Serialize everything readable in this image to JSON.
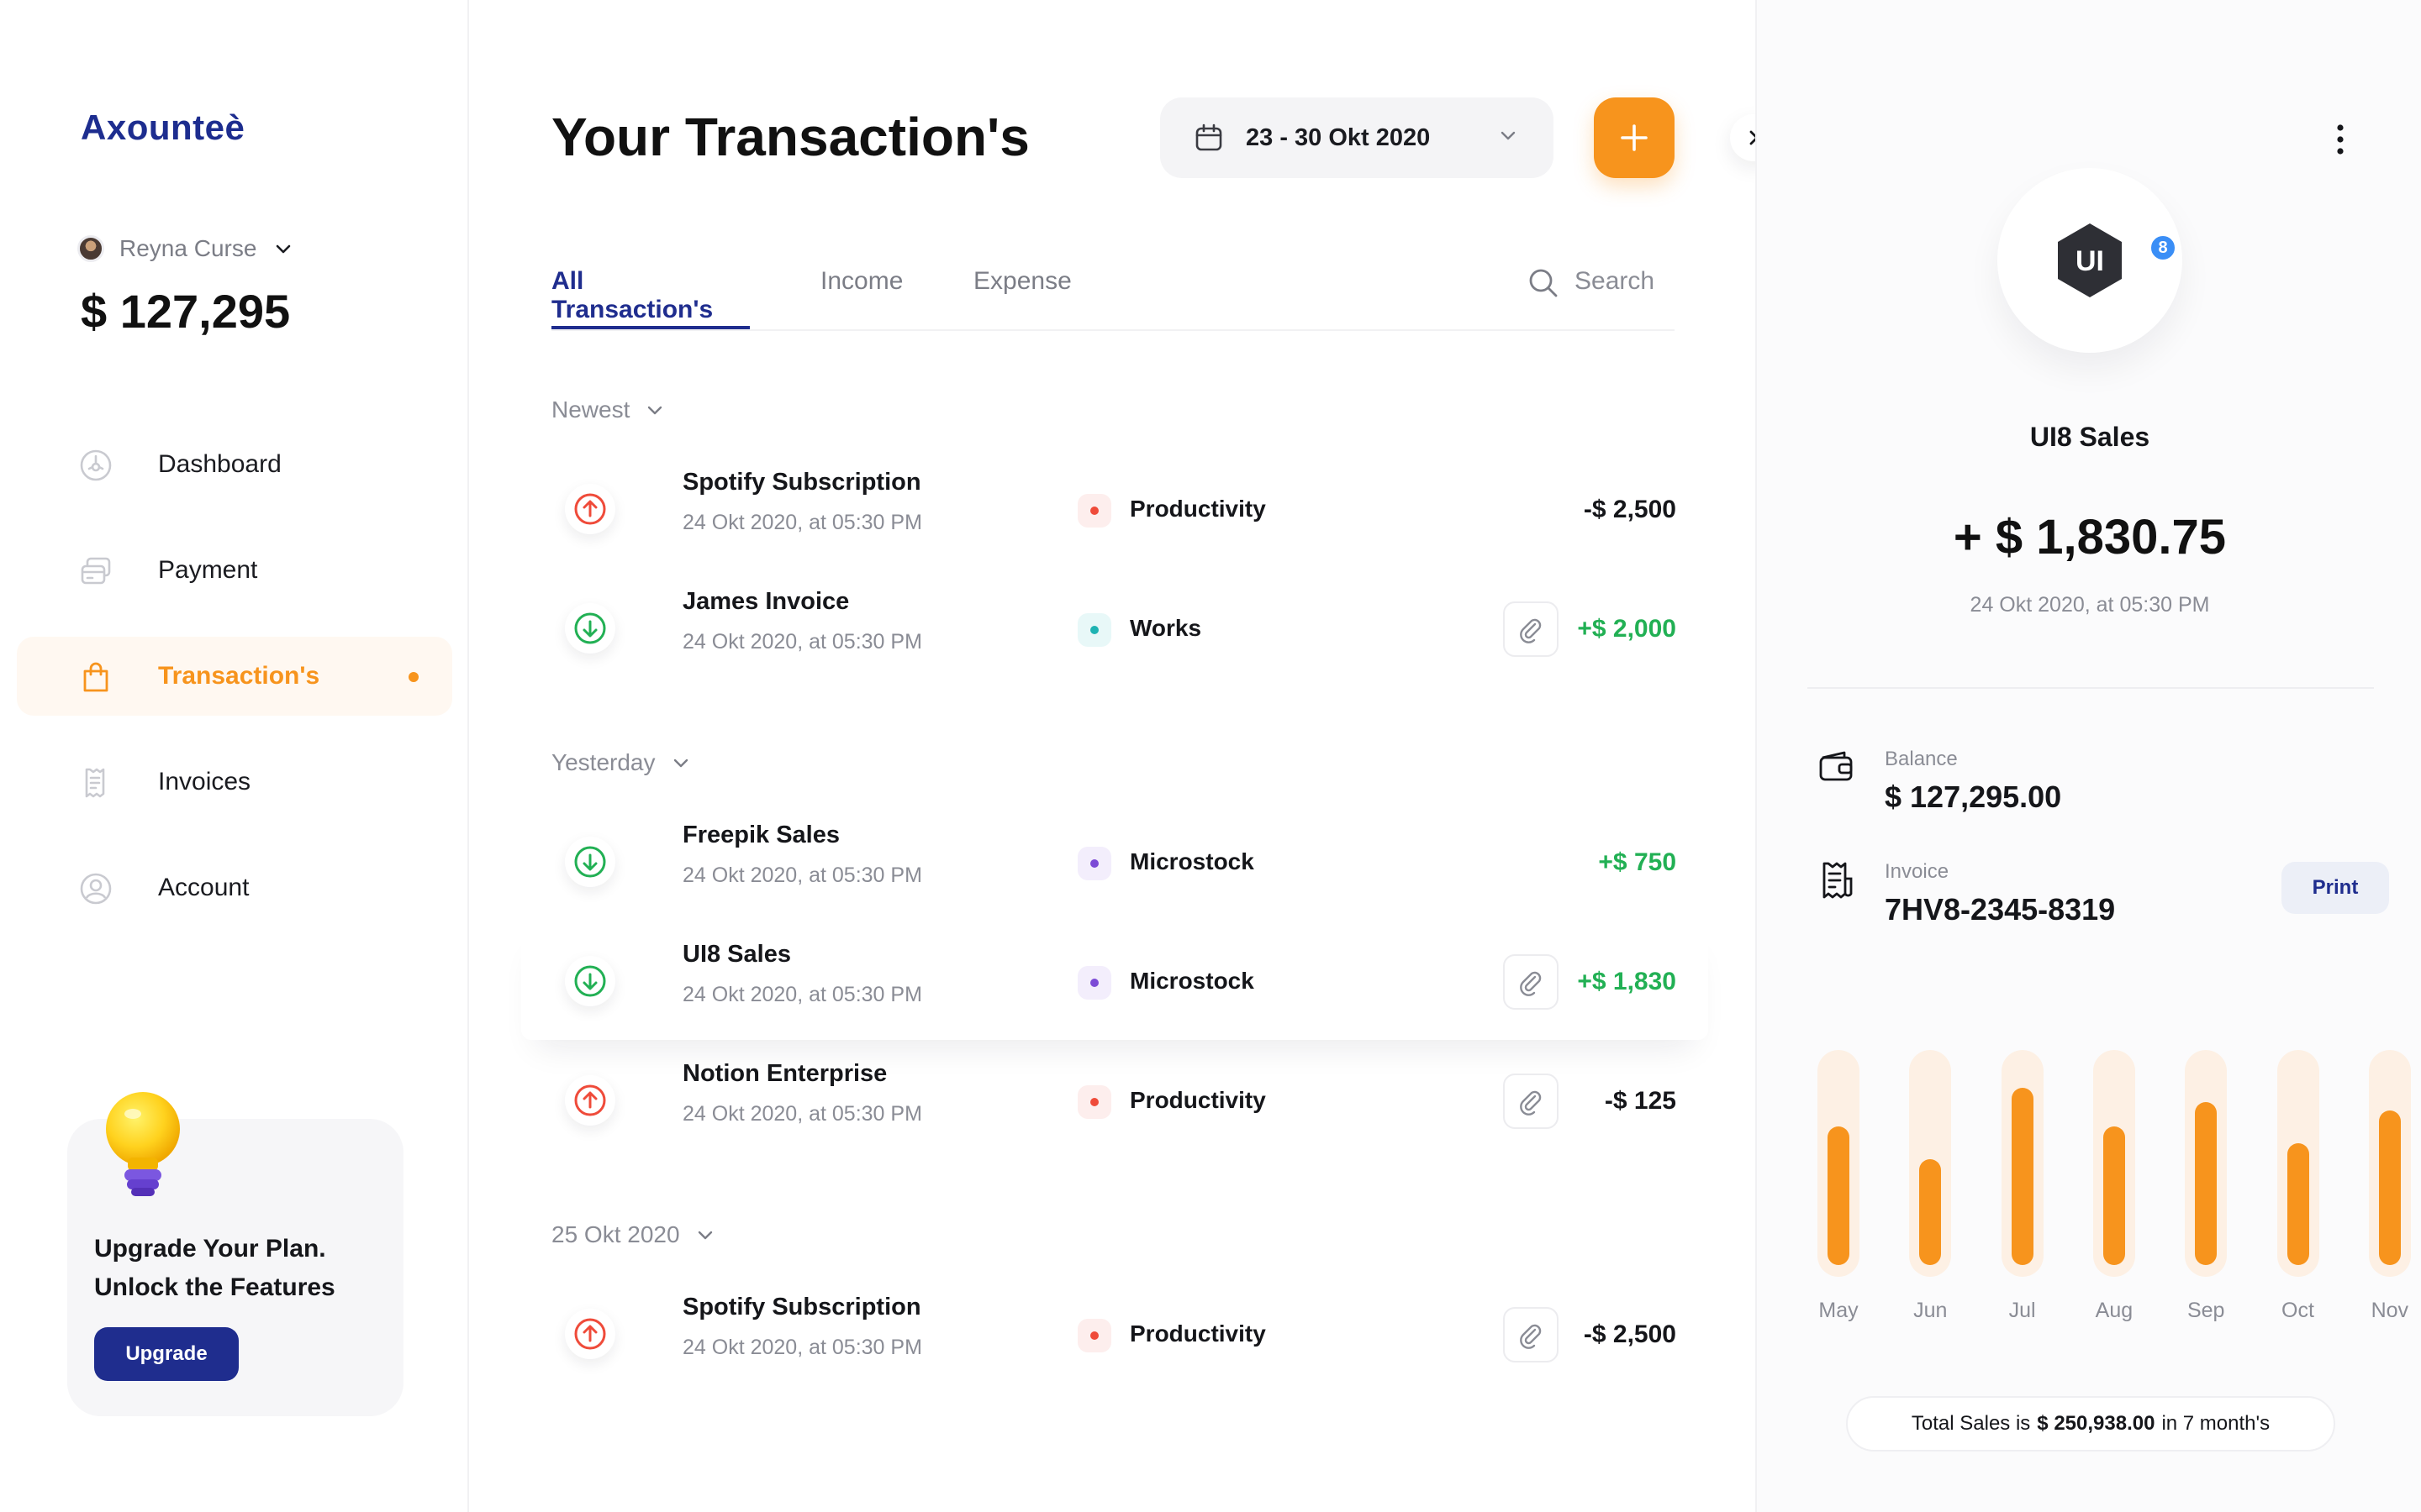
{
  "app": {
    "logo": "Axounteè"
  },
  "user": {
    "name": "Reyna Curse",
    "balance": "$ 127,295"
  },
  "nav": [
    {
      "label": "Dashboard",
      "icon": "dashboard-icon",
      "active": false
    },
    {
      "label": "Payment",
      "icon": "payment-icon",
      "active": false
    },
    {
      "label": "Transaction's",
      "icon": "shopping-bag-icon",
      "active": true
    },
    {
      "label": "Invoices",
      "icon": "invoice-icon",
      "active": false
    },
    {
      "label": "Account",
      "icon": "account-icon",
      "active": false
    }
  ],
  "upgrade": {
    "line1": "Upgrade Your Plan.",
    "line2": "Unlock the Features",
    "button": "Upgrade"
  },
  "main": {
    "title": "Your Transaction's",
    "date_range": "23 - 30 Okt 2020",
    "tabs": [
      "All Transaction's",
      "Income",
      "Expense"
    ],
    "search_placeholder": "Search",
    "groups": [
      {
        "label": "Newest"
      },
      {
        "label": "Yesterday"
      },
      {
        "label": "25 Okt 2020"
      }
    ],
    "transactions": [
      {
        "name": "Spotify Subscription",
        "date": "24 Okt 2020, at 05:30 PM",
        "category": "Productivity",
        "amount": "-$ 2,500",
        "direction": "out",
        "attachment": false
      },
      {
        "name": "James Invoice",
        "date": "24 Okt 2020, at 05:30 PM",
        "category": "Works",
        "amount": "+$ 2,000",
        "direction": "in",
        "attachment": true
      },
      {
        "name": "Freepik Sales",
        "date": "24 Okt 2020, at 05:30 PM",
        "category": "Microstock",
        "amount": "+$ 750",
        "direction": "in",
        "attachment": false
      },
      {
        "name": "UI8 Sales",
        "date": "24 Okt 2020, at 05:30 PM",
        "category": "Microstock",
        "amount": "+$ 1,830",
        "direction": "in",
        "attachment": true
      },
      {
        "name": "Notion Enterprise",
        "date": "24 Okt 2020, at 05:30 PM",
        "category": "Productivity",
        "amount": "-$ 125",
        "direction": "out",
        "attachment": true
      },
      {
        "name": "Spotify Subscription",
        "date": "24 Okt 2020, at 05:30 PM",
        "category": "Productivity",
        "amount": "-$ 2,500",
        "direction": "out",
        "attachment": true
      }
    ]
  },
  "detail": {
    "brand_text": "UI",
    "brand_badge": "8",
    "merchant": "UI8 Sales",
    "amount": "+ $ 1,830.75",
    "date": "24 Okt 2020, at 05:30 PM",
    "balance_label": "Balance",
    "balance_value": "$ 127,295.00",
    "invoice_label": "Invoice",
    "invoice_value": "7HV8-2345-8319",
    "print_label": "Print",
    "total_prefix": "Total Sales is",
    "total_value": "$ 250,938.00",
    "total_suffix": "in 7 month's"
  },
  "colors": {
    "accent": "#f7941d",
    "brand": "#1f2d8e",
    "income": "#22b054",
    "expense": "#ef4b3a"
  },
  "chart_data": {
    "type": "bar",
    "categories": [
      "May",
      "Jun",
      "Jul",
      "Aug",
      "Sep",
      "Oct",
      "Nov"
    ],
    "values": [
      0.68,
      0.52,
      0.87,
      0.68,
      0.8,
      0.6,
      0.76
    ],
    "ylim": [
      0,
      1
    ],
    "title": "",
    "xlabel": "",
    "ylabel": ""
  }
}
